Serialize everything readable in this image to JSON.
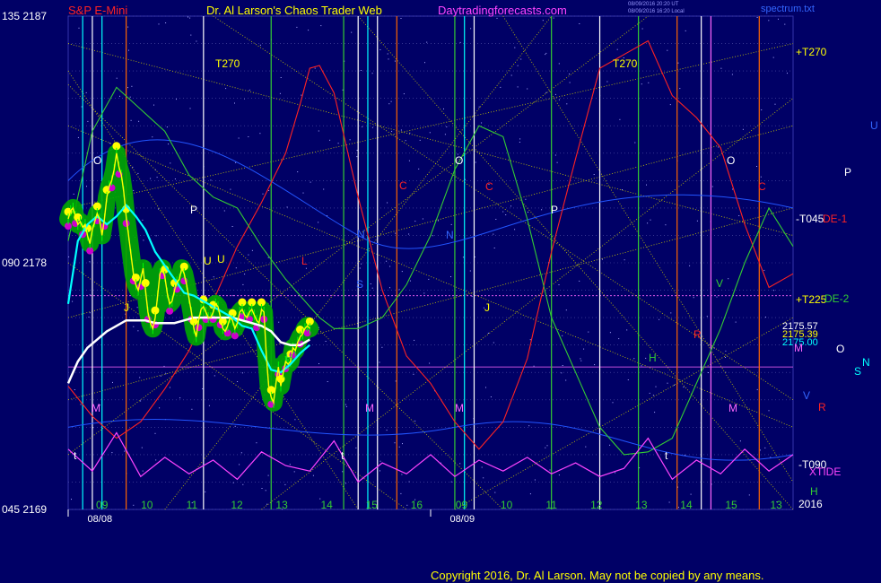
{
  "header": {
    "instrument": "S&P E-Mini",
    "site_title": "Dr. Al Larson's Chaos Trader Web",
    "site_url": "Daytradingforecasts.com",
    "stamp_line1": "08/09/2016 20:20 UT",
    "stamp_line2": "08/09/2016 16:20 Local",
    "file_name": "spectrum.txt"
  },
  "footer": {
    "copyright": "Copyright 2016, Dr. Al Larson. May not be copied by any means."
  },
  "colors": {
    "background": "#000066",
    "price": "#ffff00",
    "price_band": "#00aa00",
    "fast_avg": "#00ffff",
    "slow_avg": "#ffffff",
    "cycle": "#ff44ff",
    "forecast_red": "#ff2222",
    "forecast_green": "#33cc33"
  },
  "chart_data": {
    "type": "line",
    "title": "S&P E-Mini",
    "y_axis_left": [
      {
        "label": "135 2187",
        "value": 2187
      },
      {
        "label": "090 2178",
        "value": 2178
      },
      {
        "label": "045 2169",
        "value": 2169
      }
    ],
    "ylim": [
      2169,
      2187
    ],
    "days": [
      "08/08",
      "08/09"
    ],
    "hour_ticks": [
      "09",
      "10",
      "11",
      "12",
      "13",
      "14",
      "15",
      "16",
      "09",
      "10",
      "11",
      "12",
      "13",
      "14",
      "15",
      "13"
    ],
    "year_label": "2016",
    "price_labels": [
      "2175.57",
      "2175.39",
      "2175.00"
    ],
    "right_labels": [
      "+T270",
      "-T045",
      "+T225",
      "-T090",
      "DE-1",
      "DE-2",
      "XTIDE",
      "U",
      "P",
      "O",
      "M",
      "R",
      "N",
      "S",
      "V",
      "H"
    ],
    "grid_letters": [
      "T270",
      "T270",
      "O",
      "O",
      "O",
      "P",
      "P",
      "N",
      "N",
      "S",
      "C",
      "C",
      "C",
      "M",
      "M",
      "M",
      "M",
      "R",
      "H",
      "H",
      "t",
      "t",
      "t",
      "J",
      "J",
      "L",
      "V",
      "U",
      "U"
    ],
    "series": [
      {
        "name": "price",
        "x": [
          0,
          0.5,
          1,
          1.5,
          2,
          2.5,
          3,
          3.5,
          4,
          4.5,
          5,
          5.5,
          6,
          6.5,
          7,
          7.5,
          8,
          8.5,
          9,
          9.5,
          10,
          10.5,
          11,
          11.5,
          12,
          12.5,
          13,
          13.5,
          14,
          14.5,
          15,
          15.5,
          16,
          16.5,
          17,
          17.5,
          18,
          18.5,
          19,
          19.5,
          20,
          20.5,
          21,
          21.5,
          22,
          22.5,
          23,
          23.5,
          24,
          24.5,
          25,
          25.5,
          26,
          26.5,
          27,
          27.5,
          28,
          28.5,
          29,
          29.5,
          30,
          30.5,
          31,
          31.5,
          32,
          32.5,
          33,
          33.5,
          34,
          34.5,
          35,
          35.5,
          36,
          36.5,
          37,
          37.5,
          38,
          38.5,
          39,
          39.5,
          40,
          40.5,
          41,
          41.5,
          42,
          42.5,
          43,
          43.5,
          44,
          44.5,
          45,
          45.5,
          46,
          46.5,
          47,
          47.5,
          48,
          48.5,
          49,
          49.5,
          50
        ],
        "y": [
          2179.6,
          2179.9,
          2180.0,
          2179.7,
          2179.4,
          2179.5,
          2179.3,
          2179.4,
          2179.0,
          2178.7,
          2179.2,
          2179.5,
          2179.8,
          2179.6,
          2179.0,
          2179.6,
          2180.4,
          2180.8,
          2181.0,
          2181.4,
          2182.0,
          2181.5,
          2181.2,
          2180.6,
          2179.7,
          2179.0,
          2178.3,
          2177.6,
          2177.2,
          2177.0,
          2177.4,
          2177.8,
          2177.0,
          2176.2,
          2175.8,
          2175.6,
          2176.0,
          2176.8,
          2177.6,
          2177.8,
          2177.5,
          2176.9,
          2176.5,
          2176.6,
          2177.0,
          2177.3,
          2177.4,
          2177.8,
          2177.6,
          2177.2,
          2176.7,
          2176.2,
          2175.6,
          2175.3,
          2175.9,
          2176.3,
          2176.4,
          2176.2,
          2176.0,
          2176.0,
          2176.2,
          2176.5,
          2176.4,
          2176.0,
          2175.6,
          2175.5,
          2175.7,
          2176.0,
          2175.9,
          2175.6,
          2175.8,
          2176.2,
          2176.3,
          2176.1,
          2176.0,
          2176.2,
          2176.3,
          2176.1,
          2175.9,
          2175.8,
          2176.3,
          2176.2,
          2174.6,
          2173.5,
          2173.1,
          2172.9,
          2173.6,
          2174.2,
          2173.5,
          2174.0,
          2174.4,
          2174.3,
          2174.4,
          2174.9,
          2174.8,
          2175.1,
          2175.3,
          2175.4,
          2175.6,
          2175.7,
          2175.6
        ]
      },
      {
        "name": "fast avg",
        "x": [
          0,
          2,
          4,
          6,
          8,
          10,
          12,
          14,
          16,
          18,
          20,
          22,
          24,
          26,
          28,
          30,
          32,
          34,
          36,
          38,
          40,
          42,
          44,
          46,
          48,
          50
        ],
        "y": [
          2176.5,
          2178.8,
          2179.4,
          2179.7,
          2179.4,
          2179.7,
          2180.1,
          2179.7,
          2179.2,
          2178.4,
          2177.9,
          2177.4,
          2176.9,
          2176.8,
          2176.6,
          2176.4,
          2176.2,
          2176.0,
          2175.7,
          2175.6,
          2174.8,
          2174.1,
          2174.0,
          2174.3,
          2174.7,
          2175.0
        ]
      },
      {
        "name": "slow avg",
        "x": [
          0,
          2,
          4,
          6,
          8,
          10,
          12,
          14,
          16,
          18,
          20,
          22,
          24,
          26,
          28,
          30,
          32,
          34,
          36,
          38,
          40,
          42,
          44,
          46,
          48,
          50
        ],
        "y": [
          2173.6,
          2174.4,
          2174.9,
          2175.2,
          2175.5,
          2175.7,
          2175.9,
          2175.9,
          2175.9,
          2175.8,
          2175.8,
          2175.8,
          2175.9,
          2176.0,
          2176.0,
          2176.0,
          2176.0,
          2176.0,
          2175.9,
          2175.8,
          2175.7,
          2175.5,
          2175.1,
          2175.0,
          2175.0,
          2175.2
        ]
      },
      {
        "name": "red forecast",
        "x": [
          0,
          5,
          10,
          15,
          20,
          25,
          30,
          35,
          40,
          45,
          48,
          50,
          52,
          55,
          60,
          65,
          70,
          75,
          80,
          85,
          90,
          95,
          100,
          105,
          110,
          115,
          120,
          125,
          130,
          135,
          140,
          145,
          150
        ],
        "y": [
          2173.5,
          2172.4,
          2171.6,
          2172.2,
          2173.4,
          2174.8,
          2176.6,
          2178.6,
          2180.2,
          2182.0,
          2183.8,
          2185.1,
          2185.2,
          2184.2,
          2180.4,
          2177.0,
          2174.6,
          2173.6,
          2172.2,
          2171.2,
          2172.2,
          2174.5,
          2178.4,
          2181.8,
          2185.1,
          2185.6,
          2186.1,
          2184.1,
          2183.3,
          2182.2,
          2179.4,
          2177.1,
          2177.6
        ]
      },
      {
        "name": "green forecast",
        "x": [
          0,
          5,
          10,
          15,
          20,
          25,
          30,
          35,
          40,
          45,
          48,
          50,
          52,
          55,
          60,
          65,
          70,
          75,
          80,
          85,
          90,
          95,
          100,
          105,
          110,
          115,
          120,
          125,
          130,
          135,
          140,
          145,
          150
        ],
        "y": [
          2178.8,
          2182.8,
          2184.4,
          2183.6,
          2182.8,
          2181.2,
          2180.4,
          2180.0,
          2178.6,
          2177.4,
          2176.8,
          2176.4,
          2176.0,
          2175.6,
          2175.6,
          2176.0,
          2177.2,
          2179.0,
          2181.4,
          2183.0,
          2182.6,
          2179.6,
          2176.0,
          2174.0,
          2172.0,
          2171.0,
          2171.1,
          2171.6,
          2173.6,
          2175.6,
          2178.0,
          2180.0,
          2178.6
        ]
      },
      {
        "name": "cycle",
        "x": [
          0,
          5,
          10,
          15,
          20,
          25,
          30,
          35,
          40,
          45,
          50,
          55,
          60,
          65,
          70,
          75,
          80,
          85,
          90,
          95,
          100,
          105,
          110,
          115,
          120,
          125,
          130,
          135,
          140,
          145,
          150
        ],
        "y": [
          2171.2,
          2170.4,
          2171.8,
          2170.2,
          2170.9,
          2170.3,
          2170.8,
          2170.1,
          2171.1,
          2170.6,
          2170.4,
          2171.5,
          2170.0,
          2170.7,
          2170.3,
          2171.0,
          2170.2,
          2170.8,
          2170.4,
          2170.9,
          2170.3,
          2170.7,
          2170.2,
          2170.5,
          2171.6,
          2170.1,
          2170.8,
          2170.3,
          2171.2,
          2170.4,
          2171.0
        ]
      }
    ]
  }
}
